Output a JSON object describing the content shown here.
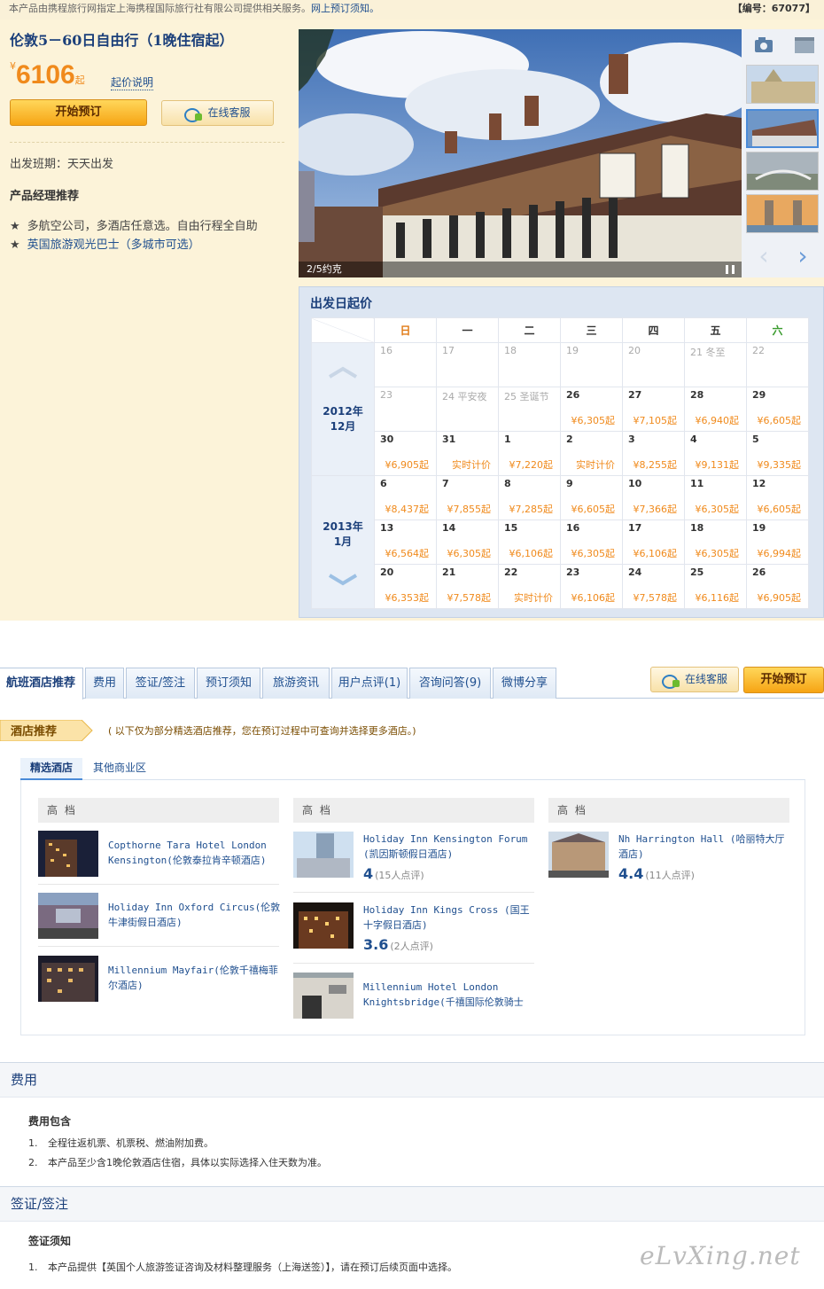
{
  "topbar": {
    "text": "本产品由携程旅行网指定上海携程国际旅行社有限公司提供相关服务。",
    "notice_link": "网上预订须知。",
    "code": "【编号：67077】"
  },
  "product": {
    "title": "伦敦5－60日自由行（1晚住宿起）",
    "price_currency": "¥",
    "price": "6106",
    "price_suffix": "起",
    "price_explain": "起价说明",
    "book_label": "开始预订",
    "cs_label": "在线客服",
    "departure": "出发班期：天天出发",
    "pm_title": "产品经理推荐",
    "recommend": [
      "多航空公司，多酒店任意选。自由行程全自助",
      "英国旅游观光巴士（多城市可选）"
    ]
  },
  "gallery": {
    "caption": "2/5约克",
    "prev_icon": "‹",
    "next_icon": "›"
  },
  "calendar": {
    "title": "出发日起价",
    "weekdays": [
      "日",
      "一",
      "二",
      "三",
      "四",
      "五",
      "六"
    ],
    "months": [
      "2012年\n12月",
      "2013年\n1月"
    ],
    "rows": [
      [
        [
          "16",
          ""
        ],
        [
          "17",
          ""
        ],
        [
          "18",
          ""
        ],
        [
          "19",
          ""
        ],
        [
          "20",
          ""
        ],
        [
          "21 冬至",
          ""
        ],
        [
          "22",
          ""
        ]
      ],
      [
        [
          "23",
          ""
        ],
        [
          "24 平安夜",
          ""
        ],
        [
          "25 圣诞节",
          ""
        ],
        [
          "26",
          "¥6,305起"
        ],
        [
          "27",
          "¥7,105起"
        ],
        [
          "28",
          "¥6,940起"
        ],
        [
          "29",
          "¥6,605起"
        ]
      ],
      [
        [
          "30",
          "¥6,905起"
        ],
        [
          "31",
          "实时计价"
        ],
        [
          "1",
          "¥7,220起"
        ],
        [
          "2",
          "实时计价"
        ],
        [
          "3",
          "¥8,255起"
        ],
        [
          "4",
          "¥9,131起"
        ],
        [
          "5",
          "¥9,335起"
        ]
      ],
      [
        [
          "6",
          "¥8,437起"
        ],
        [
          "7",
          "¥7,855起"
        ],
        [
          "8",
          "¥7,285起"
        ],
        [
          "9",
          "¥6,605起"
        ],
        [
          "10",
          "¥7,366起"
        ],
        [
          "11",
          "¥6,305起"
        ],
        [
          "12",
          "¥6,605起"
        ]
      ],
      [
        [
          "13",
          "¥6,564起"
        ],
        [
          "14",
          "¥6,305起"
        ],
        [
          "15",
          "¥6,106起"
        ],
        [
          "16",
          "¥6,305起"
        ],
        [
          "17",
          "¥6,106起"
        ],
        [
          "18",
          "¥6,305起"
        ],
        [
          "19",
          "¥6,994起"
        ]
      ],
      [
        [
          "20",
          "¥6,353起"
        ],
        [
          "21",
          "¥7,578起"
        ],
        [
          "22",
          "实时计价"
        ],
        [
          "23",
          "¥6,106起"
        ],
        [
          "24",
          "¥7,578起"
        ],
        [
          "25",
          "¥6,116起"
        ],
        [
          "26",
          "¥6,905起"
        ]
      ]
    ]
  },
  "tabs": [
    "航班酒店推荐",
    "费用",
    "签证/签注",
    "预订须知",
    "旅游资讯",
    "用户点评(1)",
    "咨询问答(9)",
    "微博分享"
  ],
  "tabbar": {
    "cs_label": "在线客服",
    "book_label": "开始预订"
  },
  "hotel_rec": {
    "label": "酒店推荐",
    "note": "( 以下仅为部分精选酒店推荐，您在预订过程中可查询并选择更多酒店。)",
    "subtabs": [
      "精选酒店",
      "其他商业区"
    ],
    "columns": [
      {
        "head": "高 档",
        "hotels": [
          {
            "name": "Copthorne Tara Hotel London Kensington(伦敦泰拉肯辛顿酒店)"
          },
          {
            "name": "Holiday Inn Oxford Circus(伦敦牛津街假日酒店)"
          },
          {
            "name": "Millennium Mayfair(伦敦千禧梅菲尔酒店)"
          }
        ]
      },
      {
        "head": "高 档",
        "hotels": [
          {
            "name": "Holiday Inn Kensington Forum (凯因斯顿假日酒店)",
            "score": "4",
            "reviews": "(15人点评)"
          },
          {
            "name": "Holiday Inn Kings Cross (国王十字假日酒店)",
            "score": "3.6",
            "reviews": "(2人点评)"
          },
          {
            "name": "Millennium Hotel London Knightsbridge(千禧国际伦敦骑士"
          }
        ]
      },
      {
        "head": "高 档",
        "hotels": [
          {
            "name": "Nh Harrington Hall (哈丽特大厅酒店)",
            "score": "4.4",
            "reviews": "(11人点评)"
          }
        ]
      }
    ]
  },
  "fee": {
    "title": "费用",
    "subtitle": "费用包含",
    "items": [
      {
        "n": "1.",
        "text": "全程往返机票、机票税、燃油附加费。"
      },
      {
        "n": "2.",
        "text": "本产品至少含1晚伦敦酒店住宿，具体以实际选择入住天数为准。"
      }
    ]
  },
  "visa": {
    "title": "签证/签注",
    "subtitle": "签证须知",
    "items": [
      {
        "n": "1.",
        "text": "本产品提供【英国个人旅游签证咨询及材料整理服务（上海送签）】，请在预订后续页面中选择。"
      }
    ]
  },
  "watermark": "eLvXing.net"
}
